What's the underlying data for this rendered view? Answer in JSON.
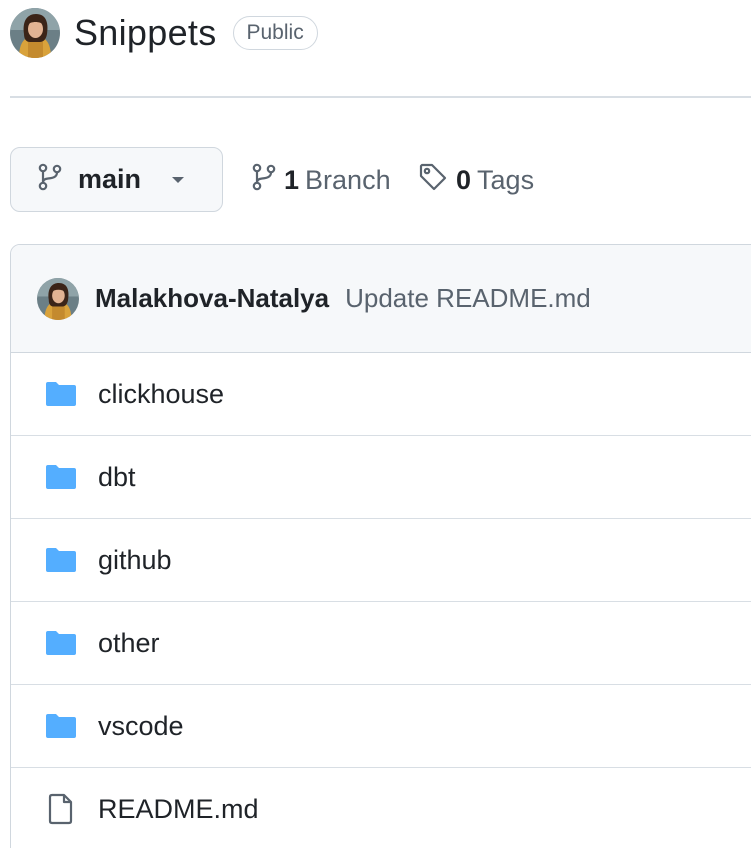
{
  "repo": {
    "name": "Snippets",
    "visibility": "Public"
  },
  "branch_bar": {
    "current_branch": "main",
    "branch_count": "1",
    "branch_label": "Branch",
    "tag_count": "0",
    "tag_label": "Tags"
  },
  "latest_commit": {
    "author": "Malakhova-Natalya",
    "message": "Update README.md"
  },
  "files": [
    {
      "name": "clickhouse",
      "type": "folder",
      "icon": "folder-icon"
    },
    {
      "name": "dbt",
      "type": "folder",
      "icon": "folder-icon"
    },
    {
      "name": "github",
      "type": "folder",
      "icon": "folder-icon"
    },
    {
      "name": "other",
      "type": "folder",
      "icon": "folder-icon"
    },
    {
      "name": "vscode",
      "type": "folder",
      "icon": "folder-icon"
    },
    {
      "name": "README.md",
      "type": "file",
      "icon": "file-icon"
    }
  ],
  "colors": {
    "folder": "#54aeff",
    "muted_text": "#59636e",
    "border": "#d0d7de",
    "subtle_bg": "#f6f8fa"
  }
}
